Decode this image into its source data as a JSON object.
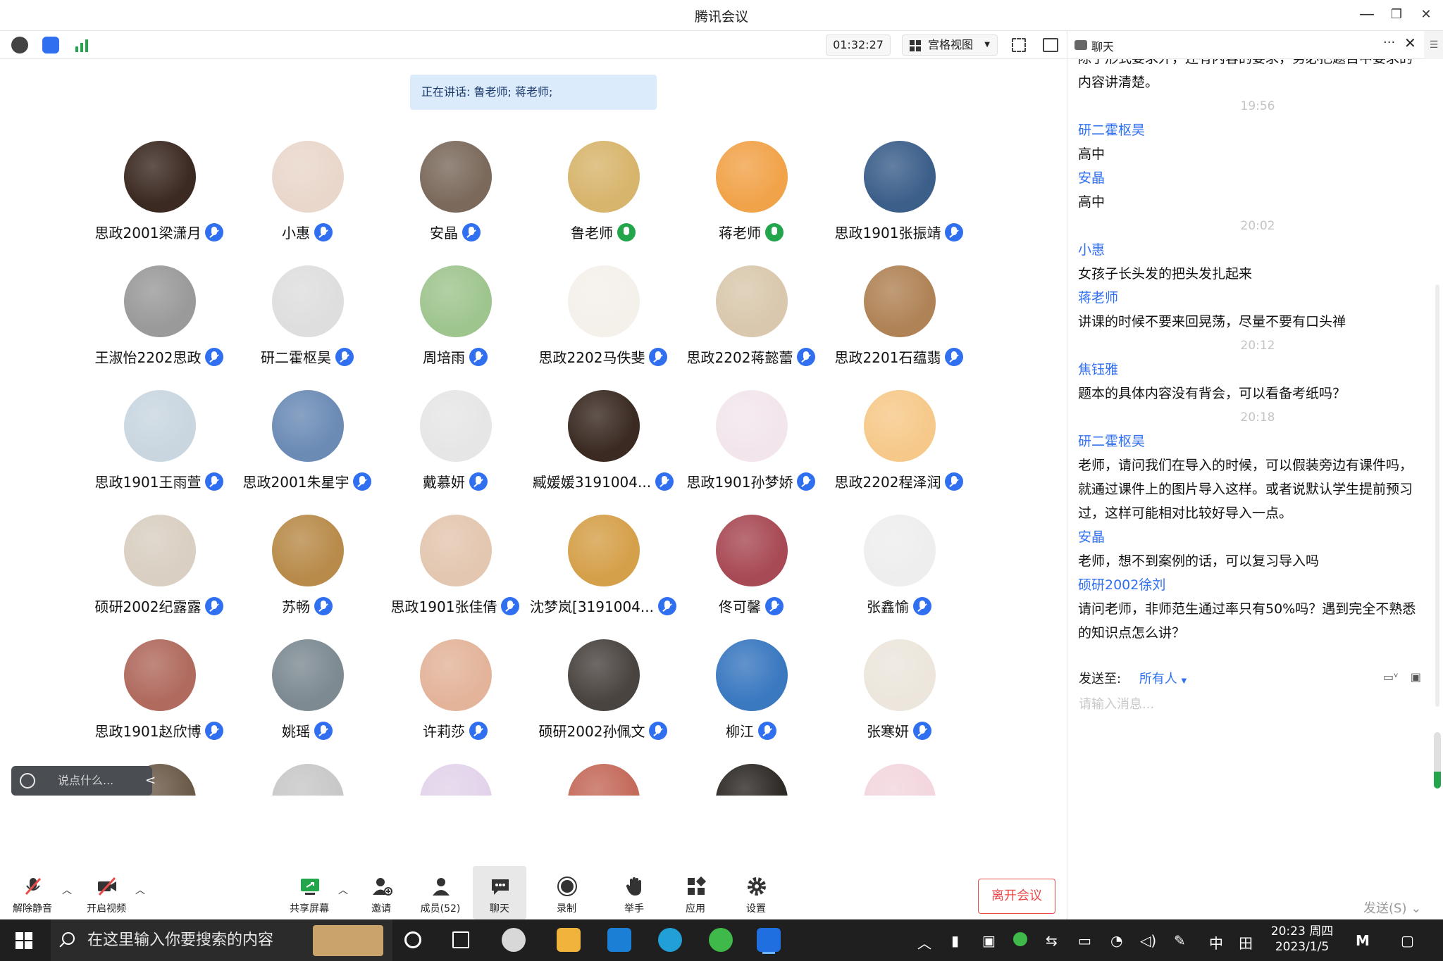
{
  "window": {
    "title": "腾讯会议",
    "minimize": "—",
    "restore": "❐",
    "close": "✕"
  },
  "toolbar": {
    "timer": "01:32:27",
    "view_mode": "宫格视图"
  },
  "speaking": "正在讲话: 鲁老师; 蒋老师;",
  "participants": [
    {
      "name": "思政2001梁潇月",
      "color": "#3b2a22",
      "active": false
    },
    {
      "name": "小惠",
      "color": "#e9d7cb",
      "active": false
    },
    {
      "name": "安晶",
      "color": "#7b6a5c",
      "active": false
    },
    {
      "name": "鲁老师",
      "color": "#d8b56d",
      "active": true
    },
    {
      "name": "蒋老师",
      "color": "#f1a34a",
      "active": true
    },
    {
      "name": "思政1901张振靖",
      "color": "#3c5f8a",
      "active": false
    },
    {
      "name": "王淑怡2202思政",
      "color": "#9a9a9a",
      "active": false
    },
    {
      "name": "研二霍枢昊",
      "color": "#dedede",
      "active": false
    },
    {
      "name": "周培雨",
      "color": "#9fc58f",
      "active": false
    },
    {
      "name": "思政2202马佚斐",
      "color": "#f4f0ea",
      "active": false
    },
    {
      "name": "思政2202蒋懿蕾",
      "color": "#d9c8ad",
      "active": false
    },
    {
      "name": "思政2201石蕴翡",
      "color": "#b08356",
      "active": false
    },
    {
      "name": "思政1901王雨萱",
      "color": "#c9d6e0",
      "active": false
    },
    {
      "name": "思政2001朱星宇",
      "color": "#6b8bb5",
      "active": false
    },
    {
      "name": "戴慕妍",
      "color": "#e6e6e6",
      "active": false
    },
    {
      "name": "臧媛媛3191004...",
      "color": "#3a2a22",
      "active": false
    },
    {
      "name": "思政1901孙梦娇",
      "color": "#f2e6ec",
      "active": false
    },
    {
      "name": "思政2202程泽润",
      "color": "#f6c98a",
      "active": false
    },
    {
      "name": "硕研2002纪露露",
      "color": "#d9cfc2",
      "active": false
    },
    {
      "name": "苏畅",
      "color": "#b88b4a",
      "active": false
    },
    {
      "name": "思政1901张佳倩",
      "color": "#e3c7b0",
      "active": false
    },
    {
      "name": "沈梦岚[3191004...",
      "color": "#d5a04a",
      "active": false
    },
    {
      "name": "佟可馨",
      "color": "#a84a55",
      "active": false
    },
    {
      "name": "张鑫愉",
      "color": "#eeeeee",
      "active": false
    },
    {
      "name": "思政1901赵欣博",
      "color": "#b06a5e",
      "active": false
    },
    {
      "name": "姚瑶",
      "color": "#7d8a92",
      "active": false
    },
    {
      "name": "许莉莎",
      "color": "#e3b49a",
      "active": false
    },
    {
      "name": "硕研2002孙佩文",
      "color": "#4a4440",
      "active": false
    },
    {
      "name": "柳江",
      "color": "#3a78c0",
      "active": false
    },
    {
      "name": "张寒妍",
      "color": "#ece6dc",
      "active": false
    }
  ],
  "partial_row_colors": [
    "#6b5a48",
    "#c8c8c8",
    "#e2d3ea",
    "#c46a5a",
    "#2e2a26",
    "#f3d6de"
  ],
  "say_box": {
    "placeholder": "说点什么...",
    "arrow": "<"
  },
  "bottom": {
    "unmute": "解除静音",
    "start_video": "开启视频",
    "share_screen": "共享屏幕",
    "invite": "邀请",
    "members": "成员(52)",
    "chat": "聊天",
    "record": "录制",
    "raise_hand": "举手",
    "apps": "应用",
    "settings": "设置",
    "leave": "离开会议"
  },
  "chat": {
    "title": "聊天",
    "more": "···",
    "close": "✕",
    "side": "☰",
    "lines": [
      {
        "type": "text",
        "text": "除了形式要求外，还有内容的要求，务必把题目中要求的",
        "cls": "first"
      },
      {
        "type": "text",
        "text": "内容讲清楚。"
      },
      {
        "type": "time",
        "text": "19:56"
      },
      {
        "type": "sender",
        "text": "研二霍枢昊"
      },
      {
        "type": "text",
        "text": "高中"
      },
      {
        "type": "sender",
        "text": "安晶"
      },
      {
        "type": "text",
        "text": "高中"
      },
      {
        "type": "time",
        "text": "20:02"
      },
      {
        "type": "sender",
        "text": "小惠"
      },
      {
        "type": "text",
        "text": "女孩子长头发的把头发扎起来"
      },
      {
        "type": "sender",
        "text": "蒋老师"
      },
      {
        "type": "text",
        "text": "讲课的时候不要来回晃荡，尽量不要有口头禅"
      },
      {
        "type": "time",
        "text": "20:12"
      },
      {
        "type": "sender",
        "text": "焦钰雅"
      },
      {
        "type": "text",
        "text": "题本的具体内容没有背会，可以看备考纸吗？"
      },
      {
        "type": "time",
        "text": "20:18"
      },
      {
        "type": "sender",
        "text": "研二霍枢昊"
      },
      {
        "type": "text",
        "text": "老师，请问我们在导入的时候，可以假装旁边有课件吗，"
      },
      {
        "type": "text",
        "text": "就通过课件上的图片导入这样。或者说默认学生提前预习"
      },
      {
        "type": "text",
        "text": "过，这样可能相对比较好导入一点。"
      },
      {
        "type": "sender",
        "text": "安晶"
      },
      {
        "type": "text",
        "text": "老师，想不到案例的话，可以复习导入吗"
      },
      {
        "type": "sender",
        "text": "硕研2002徐刘"
      },
      {
        "type": "text",
        "text": "请问老师，非师范生通过率只有50%吗？遇到完全不熟悉"
      },
      {
        "type": "text",
        "text": "的知识点怎么讲？"
      }
    ],
    "send_to_label": "发送至:",
    "send_to_value": "所有人",
    "input_placeholder": "请输入消息...",
    "send_button": "发送(S)",
    "mic_level": 0.3
  },
  "taskbar": {
    "search_placeholder": "在这里输入你要搜索的内容",
    "ime": "中",
    "time": "20:23 周四",
    "date": "2023/1/5"
  }
}
